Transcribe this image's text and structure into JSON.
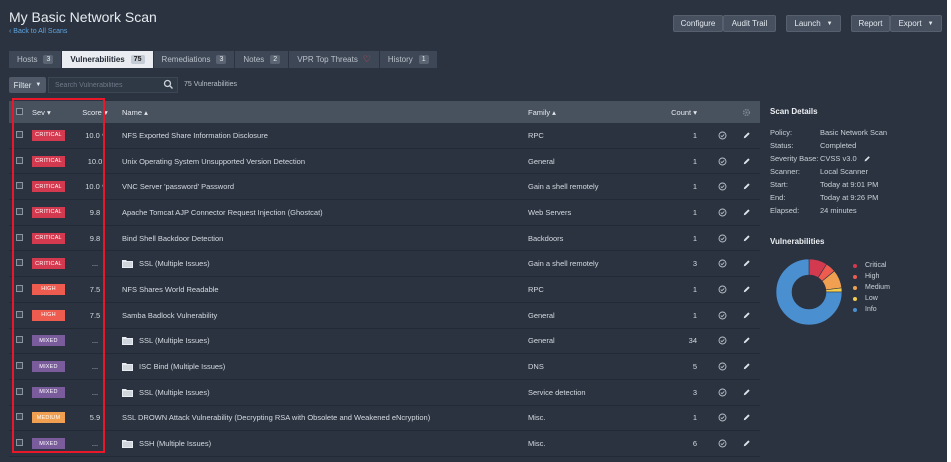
{
  "header": {
    "title": "My Basic Network Scan",
    "back_link": "‹ Back to All Scans",
    "buttons": {
      "configure": "Configure",
      "audit_trail": "Audit Trail",
      "launch": "Launch",
      "report": "Report",
      "export": "Export"
    }
  },
  "tabs": [
    {
      "label": "Hosts",
      "count": "3"
    },
    {
      "label": "Vulnerabilities",
      "count": "75"
    },
    {
      "label": "Remediations",
      "count": "3"
    },
    {
      "label": "Notes",
      "count": "2"
    },
    {
      "label": "VPR Top Threats",
      "count": ""
    },
    {
      "label": "History",
      "count": "1"
    }
  ],
  "filter": {
    "label": "Filter",
    "placeholder": "Search Vulnerabilities",
    "count_text": "75 Vulnerabilities"
  },
  "table": {
    "headers": {
      "sev": "Sev ▾",
      "score": "Score ▾",
      "name": "Name ▴",
      "family": "Family ▴",
      "count": "Count ▾"
    },
    "rows": [
      {
        "sev": "CRITICAL",
        "score": "10.0 *",
        "name": "NFS Exported Share Information Disclosure",
        "family": "RPC",
        "count": "1",
        "folder": false
      },
      {
        "sev": "CRITICAL",
        "score": "10.0",
        "name": "Unix Operating System Unsupported Version Detection",
        "family": "General",
        "count": "1",
        "folder": false
      },
      {
        "sev": "CRITICAL",
        "score": "10.0 *",
        "name": "VNC Server 'password' Password",
        "family": "Gain a shell remotely",
        "count": "1",
        "folder": false
      },
      {
        "sev": "CRITICAL",
        "score": "9.8",
        "name": "Apache Tomcat AJP Connector Request Injection (Ghostcat)",
        "family": "Web Servers",
        "count": "1",
        "folder": false
      },
      {
        "sev": "CRITICAL",
        "score": "9.8",
        "name": "Bind Shell Backdoor Detection",
        "family": "Backdoors",
        "count": "1",
        "folder": false
      },
      {
        "sev": "CRITICAL",
        "score": "...",
        "name": "SSL (Multiple Issues)",
        "family": "Gain a shell remotely",
        "count": "3",
        "folder": true
      },
      {
        "sev": "HIGH",
        "score": "7.5",
        "name": "NFS Shares World Readable",
        "family": "RPC",
        "count": "1",
        "folder": false
      },
      {
        "sev": "HIGH",
        "score": "7.5",
        "name": "Samba Badlock Vulnerability",
        "family": "General",
        "count": "1",
        "folder": false
      },
      {
        "sev": "MIXED",
        "score": "...",
        "name": "SSL (Multiple Issues)",
        "family": "General",
        "count": "34",
        "folder": true
      },
      {
        "sev": "MIXED",
        "score": "...",
        "name": "ISC Bind (Multiple Issues)",
        "family": "DNS",
        "count": "5",
        "folder": true
      },
      {
        "sev": "MIXED",
        "score": "...",
        "name": "SSL (Multiple Issues)",
        "family": "Service detection",
        "count": "3",
        "folder": true
      },
      {
        "sev": "MEDIUM",
        "score": "5.9",
        "name": "SSL DROWN Attack Vulnerability (Decrypting RSA with Obsolete and Weakened eNcryption)",
        "family": "Misc.",
        "count": "1",
        "folder": false
      },
      {
        "sev": "MIXED",
        "score": "...",
        "name": "SSH (Multiple Issues)",
        "family": "Misc.",
        "count": "6",
        "folder": true
      }
    ]
  },
  "scan_details": {
    "title": "Scan Details",
    "fields": [
      {
        "key": "Policy:",
        "value": "Basic Network Scan"
      },
      {
        "key": "Status:",
        "value": "Completed"
      },
      {
        "key": "Severity Base:",
        "value": "CVSS v3.0"
      },
      {
        "key": "Scanner:",
        "value": "Local Scanner"
      },
      {
        "key": "Start:",
        "value": "Today at 9:01 PM"
      },
      {
        "key": "End:",
        "value": "Today at 9:26 PM"
      },
      {
        "key": "Elapsed:",
        "value": "24 minutes"
      }
    ]
  },
  "vulnerabilities_chart": {
    "title": "Vulnerabilities",
    "legend": [
      {
        "label": "Critical",
        "color": "#d43a4f",
        "share": 0.09
      },
      {
        "label": "High",
        "color": "#ee5b4f",
        "share": 0.05
      },
      {
        "label": "Medium",
        "color": "#f0a050",
        "share": 0.09
      },
      {
        "label": "Low",
        "color": "#f5cd4c",
        "share": 0.02
      },
      {
        "label": "Info",
        "color": "#4a8fd0",
        "share": 0.75
      }
    ]
  },
  "colors": {
    "critical": "#d43a4f",
    "high": "#ee5b4f",
    "medium": "#f0a050",
    "low": "#f5cd4c",
    "info": "#4a8fd0",
    "mixed": "#7a5c9c",
    "selection_outline": "#e8182a"
  }
}
